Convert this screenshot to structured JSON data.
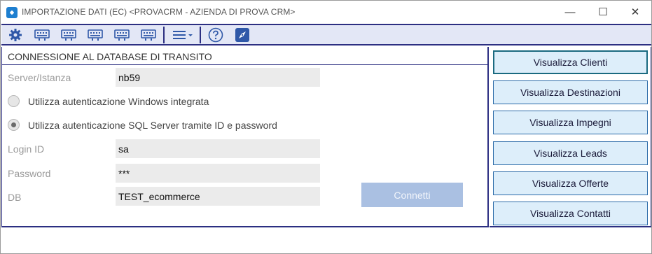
{
  "window": {
    "title": "IMPORTAZIONE DATI (EC) <PROVACRM - AZIENDA DI PROVA CRM>",
    "controls": {
      "minimize": "—",
      "maximize": "☐",
      "close": "✕"
    }
  },
  "toolbar": {
    "icons": [
      "gear-icon",
      "keyboard-icon",
      "keyboard-icon",
      "keyboard-icon",
      "keyboard-icon",
      "keyboard-icon",
      "menu-dropdown-icon",
      "help-icon",
      "compass-icon"
    ],
    "accent": "#2c2f82"
  },
  "connection": {
    "section_title": "CONNESSIONE AL DATABASE DI TRANSITO",
    "server_label": "Server/Istanza",
    "server_value": "nb59",
    "auth_windows_label": "Utilizza autenticazione Windows integrata",
    "auth_sql_label": "Utilizza autenticazione SQL Server tramite ID e password",
    "auth_selected": "sql",
    "login_label": "Login ID",
    "login_value": "sa",
    "password_label": "Password",
    "password_value": "***",
    "db_label": "DB",
    "db_value": "TEST_ecommerce",
    "connect_label": "Connetti"
  },
  "actions": [
    {
      "label": "Visualizza Clienti"
    },
    {
      "label": "Visualizza Destinazioni"
    },
    {
      "label": "Visualizza Impegni"
    },
    {
      "label": "Visualizza Leads"
    },
    {
      "label": "Visualizza Offerte"
    },
    {
      "label": "Visualizza Contatti"
    }
  ]
}
